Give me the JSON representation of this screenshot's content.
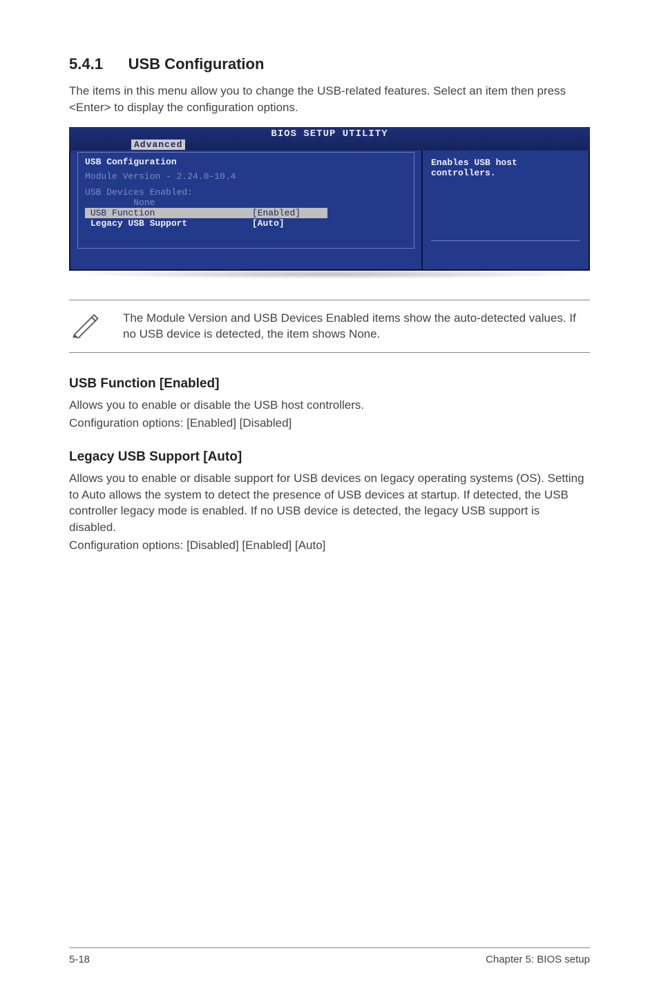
{
  "section": {
    "number": "5.4.1",
    "title": "USB Configuration",
    "intro": "The items in this menu allow you to change the USB-related features. Select an item then press <Enter> to display the configuration options."
  },
  "bios": {
    "title": "BIOS SETUP UTILITY",
    "tab": "Advanced",
    "panel_heading": "USB Configuration",
    "module_line": "Module Version - 2.24.0-10.4",
    "devices_label": "USB Devices Enabled:",
    "devices_value": "None",
    "row_usb_function_label": "USB Function",
    "row_usb_function_value": "[Enabled]",
    "row_legacy_label": "Legacy USB Support",
    "row_legacy_value": "[Auto]",
    "help_line1": "Enables USB host",
    "help_line2": "controllers."
  },
  "note": {
    "text": "The Module Version and USB Devices Enabled items show the auto-detected values. If no USB device is detected, the item shows None."
  },
  "usb_function": {
    "heading": "USB Function [Enabled]",
    "line1": "Allows you to enable or disable the USB host controllers.",
    "line2": "Configuration options: [Enabled] [Disabled]"
  },
  "legacy": {
    "heading": "Legacy USB Support [Auto]",
    "line1": "Allows you to enable or disable support for USB devices on legacy operating systems (OS). Setting to Auto allows the system to detect the presence of USB devices at startup. If detected, the USB controller legacy mode is enabled. If no USB device is detected, the legacy USB support is disabled.",
    "line2": "Configuration options: [Disabled] [Enabled] [Auto]"
  },
  "footer": {
    "left": "5-18",
    "right": "Chapter 5: BIOS setup"
  }
}
